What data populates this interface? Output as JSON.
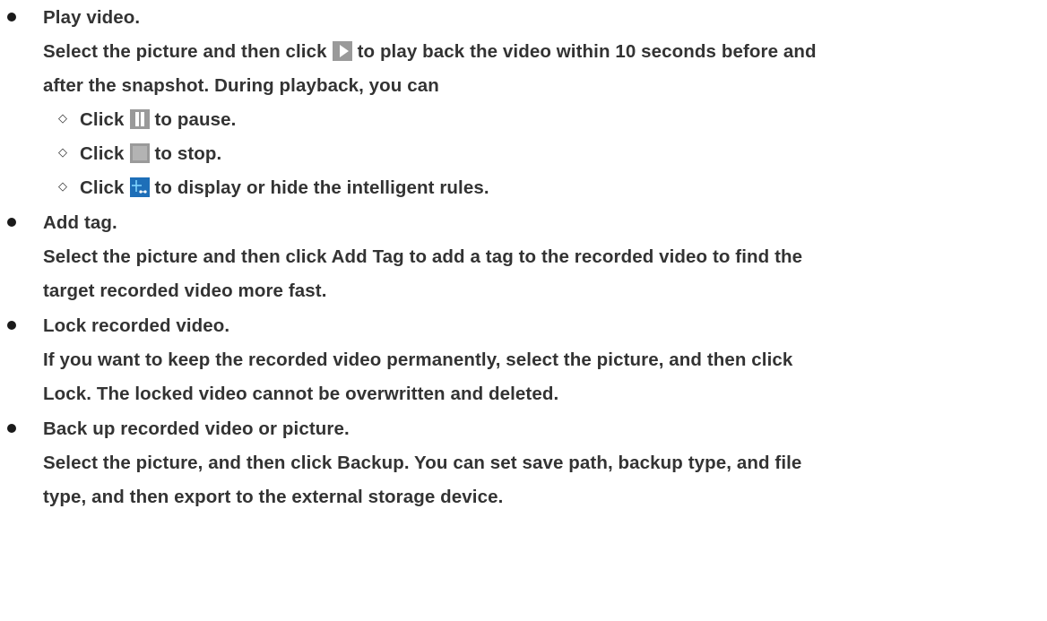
{
  "items": [
    {
      "heading": "Play video.",
      "body_line_1_before": "Select the picture and then click",
      "body_line_1_after": "to play back the video within 10 seconds before and",
      "body_line_2": "after the snapshot. During playback, you can",
      "sub_items": [
        {
          "before": "Click",
          "after": "to pause.",
          "icon": "pause-icon"
        },
        {
          "before": "Click",
          "after": "to stop.",
          "icon": "stop-icon"
        },
        {
          "before": "Click",
          "after": "to display or hide the intelligent rules.",
          "icon": "intelligent-rules-icon"
        }
      ],
      "icon": "play-icon"
    },
    {
      "heading": "Add tag.",
      "body_line_1": "Select the picture and then click Add Tag to add a tag to the recorded video to find the",
      "body_line_2": "target recorded video more fast."
    },
    {
      "heading": "Lock recorded video.",
      "body_line_1": "If you want to keep the recorded video permanently, select the picture, and then click",
      "body_line_2": "Lock. The locked video cannot be overwritten and deleted."
    },
    {
      "heading": "Back up recorded video or picture.",
      "body_line_1": "Select the picture, and then click Backup. You can set save path, backup type, and file",
      "body_line_2": "type, and then export to the external storage device."
    }
  ],
  "colors": {
    "text": "#333333",
    "icon_gray": "#9a9a9a",
    "icon_blue": "#1e6fb8"
  },
  "bullet_symbol": "◇"
}
